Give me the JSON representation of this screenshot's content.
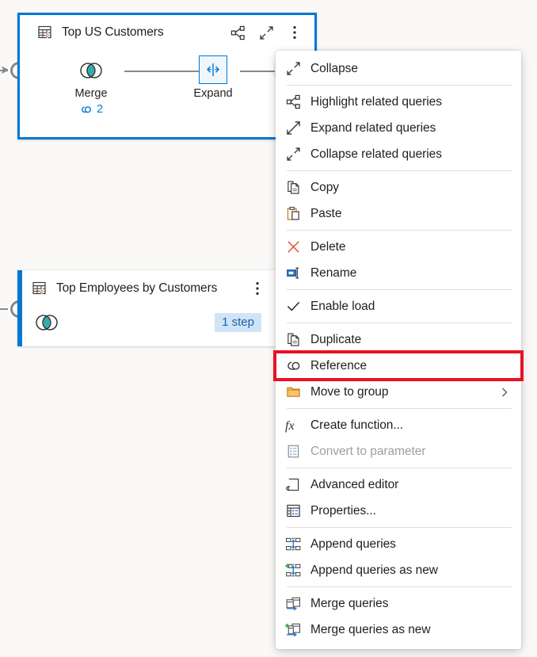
{
  "canvas": {
    "background": "#faf9f8",
    "accent": "#0078d4",
    "highlight_color": "#e81123"
  },
  "queries": [
    {
      "title": "Top US Customers",
      "selected": true,
      "icon": "table-with-lightning-icon",
      "header_actions": [
        {
          "name": "highlight-related-queries-icon",
          "label": "Highlight related queries"
        },
        {
          "name": "collapse-icon",
          "label": "Collapse"
        },
        {
          "name": "more-options-icon",
          "label": "More options"
        }
      ],
      "steps": [
        {
          "label": "Merge",
          "icon": "merge-icon",
          "refs": "2",
          "refs_icon": "reference-link-icon",
          "selected": false
        },
        {
          "label": "Expand",
          "icon": "expand-columns-icon",
          "refs": null,
          "selected": true
        }
      ],
      "add_step_label": "+"
    },
    {
      "title": "Top Employees by Customers",
      "selected": false,
      "icon": "table-with-lightning-icon",
      "header_actions": [
        {
          "name": "more-options-icon",
          "label": "More options"
        }
      ],
      "steps": [
        {
          "label": "",
          "icon": "merge-icon",
          "refs": null,
          "selected": false
        }
      ],
      "step_count_badge": "1 step"
    }
  ],
  "context_menu": {
    "groups": [
      {
        "items": [
          {
            "label": "Collapse",
            "icon": "collapse-icon",
            "disabled": false,
            "submenu": false,
            "checked": false,
            "highlighted": false
          }
        ]
      },
      {
        "items": [
          {
            "label": "Highlight related queries",
            "icon": "highlight-related-queries-icon",
            "disabled": false,
            "submenu": false,
            "checked": false,
            "highlighted": false
          },
          {
            "label": "Expand related queries",
            "icon": "expand-related-queries-icon",
            "disabled": false,
            "submenu": false,
            "checked": false,
            "highlighted": false
          },
          {
            "label": "Collapse related queries",
            "icon": "collapse-related-queries-icon",
            "disabled": false,
            "submenu": false,
            "checked": false,
            "highlighted": false
          }
        ]
      },
      {
        "items": [
          {
            "label": "Copy",
            "icon": "copy-icon",
            "disabled": false,
            "submenu": false,
            "checked": false,
            "highlighted": false
          },
          {
            "label": "Paste",
            "icon": "paste-icon",
            "disabled": false,
            "submenu": false,
            "checked": false,
            "highlighted": false
          }
        ]
      },
      {
        "items": [
          {
            "label": "Delete",
            "icon": "delete-x-icon",
            "disabled": false,
            "submenu": false,
            "checked": false,
            "highlighted": false
          },
          {
            "label": "Rename",
            "icon": "rename-icon",
            "disabled": false,
            "submenu": false,
            "checked": false,
            "highlighted": false
          }
        ]
      },
      {
        "items": [
          {
            "label": "Enable load",
            "icon": "checkmark-icon",
            "disabled": false,
            "submenu": false,
            "checked": true,
            "highlighted": false
          }
        ]
      },
      {
        "items": [
          {
            "label": "Duplicate",
            "icon": "duplicate-icon",
            "disabled": false,
            "submenu": false,
            "checked": false,
            "highlighted": false
          },
          {
            "label": "Reference",
            "icon": "reference-link-icon",
            "disabled": false,
            "submenu": false,
            "checked": false,
            "highlighted": true
          },
          {
            "label": "Move to group",
            "icon": "folder-icon",
            "disabled": false,
            "submenu": true,
            "checked": false,
            "highlighted": false
          }
        ]
      },
      {
        "items": [
          {
            "label": "Create function...",
            "icon": "fx-icon",
            "disabled": false,
            "submenu": false,
            "checked": false,
            "highlighted": false
          },
          {
            "label": "Convert to parameter",
            "icon": "parameter-icon",
            "disabled": true,
            "submenu": false,
            "checked": false,
            "highlighted": false
          }
        ]
      },
      {
        "items": [
          {
            "label": "Advanced editor",
            "icon": "advanced-editor-icon",
            "disabled": false,
            "submenu": false,
            "checked": false,
            "highlighted": false
          },
          {
            "label": "Properties...",
            "icon": "properties-icon",
            "disabled": false,
            "submenu": false,
            "checked": false,
            "highlighted": false
          }
        ]
      },
      {
        "items": [
          {
            "label": "Append queries",
            "icon": "append-queries-icon",
            "disabled": false,
            "submenu": false,
            "checked": false,
            "highlighted": false
          },
          {
            "label": "Append queries as new",
            "icon": "append-queries-as-new-icon",
            "disabled": false,
            "submenu": false,
            "checked": false,
            "highlighted": false
          }
        ]
      },
      {
        "items": [
          {
            "label": "Merge queries",
            "icon": "merge-queries-icon",
            "disabled": false,
            "submenu": false,
            "checked": false,
            "highlighted": false
          },
          {
            "label": "Merge queries as new",
            "icon": "merge-queries-as-new-icon",
            "disabled": false,
            "submenu": false,
            "checked": false,
            "highlighted": false
          }
        ]
      }
    ]
  }
}
